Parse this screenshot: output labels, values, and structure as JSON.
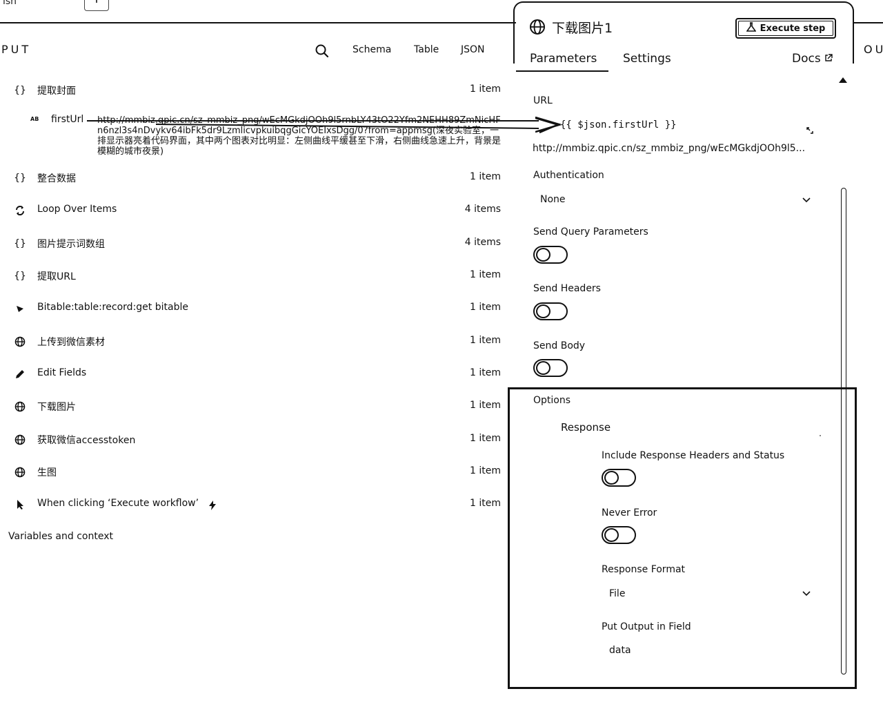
{
  "top": {
    "cut_text": "ish"
  },
  "input_panel": {
    "title": "PUT",
    "view_tabs": [
      "Schema",
      "Table",
      "JSON"
    ],
    "nodes": [
      {
        "icon": "braces-icon",
        "label": "提取封面",
        "count": "1 item"
      },
      {
        "icon": "braces-icon",
        "label": "整合数据",
        "count": "1 item"
      },
      {
        "icon": "loop-icon",
        "label": "Loop Over Items",
        "count": "4 items"
      },
      {
        "icon": "braces-icon",
        "label": "图片提示词数组",
        "count": "4 items"
      },
      {
        "icon": "braces-icon",
        "label": "提取URL",
        "count": "1 item"
      },
      {
        "icon": "bitable-icon",
        "label": "Bitable:table:record:get bitable",
        "count": "1 item"
      },
      {
        "icon": "globe-icon",
        "label": "上传到微信素材",
        "count": "1 item"
      },
      {
        "icon": "pencil-icon",
        "label": "Edit Fields",
        "count": "1 item"
      },
      {
        "icon": "globe-icon",
        "label": "下载图片",
        "count": "1 item"
      },
      {
        "icon": "globe-icon",
        "label": "获取微信accesstoken",
        "count": "1 item"
      },
      {
        "icon": "globe-icon",
        "label": "生图",
        "count": "1 item"
      },
      {
        "icon": "cursor-icon",
        "label": "When clicking ‘Execute workflow’",
        "count": "1 item"
      }
    ],
    "field": {
      "type_badge": "AB",
      "name": "firstUrl",
      "value": "http://mmbiz.qpic.cn/sz_mmbiz_png/wEcMGkdjOOh9l5rnbLY43tO22Yfm2NEHH89ZmNicHFn6nzl3s4nDvykv64ibFk5dr9LzmlicvpkuibqgGicYOEIxsDgg/0?from=appmsg(深夜实验室，一排显示器亮着代码界面，其中两个图表对比明显：左侧曲线平缓甚至下滑，右侧曲线急速上升，背景是模糊的城市夜景)"
    },
    "variables_label": "Variables and context"
  },
  "ndv": {
    "title": "下载图片1",
    "execute_label": "Execute step",
    "tabs": [
      "Parameters",
      "Settings"
    ],
    "docs_label": "Docs",
    "output_peek": "OU",
    "params": {
      "url_label": "URL",
      "url_expression": "{{ $json.firstUrl }}",
      "url_preview": "http://mmbiz.qpic.cn/sz_mmbiz_png/wEcMGkdjOOh9l5...",
      "auth_label": "Authentication",
      "auth_value": "None",
      "send_query_label": "Send Query Parameters",
      "send_headers_label": "Send Headers",
      "send_body_label": "Send Body",
      "options_label": "Options",
      "response_label": "Response",
      "include_headers_label": "Include Response Headers and Status",
      "never_error_label": "Never Error",
      "response_format_label": "Response Format",
      "response_format_value": "File",
      "output_field_label": "Put Output in Field",
      "output_field_value": "data"
    }
  }
}
